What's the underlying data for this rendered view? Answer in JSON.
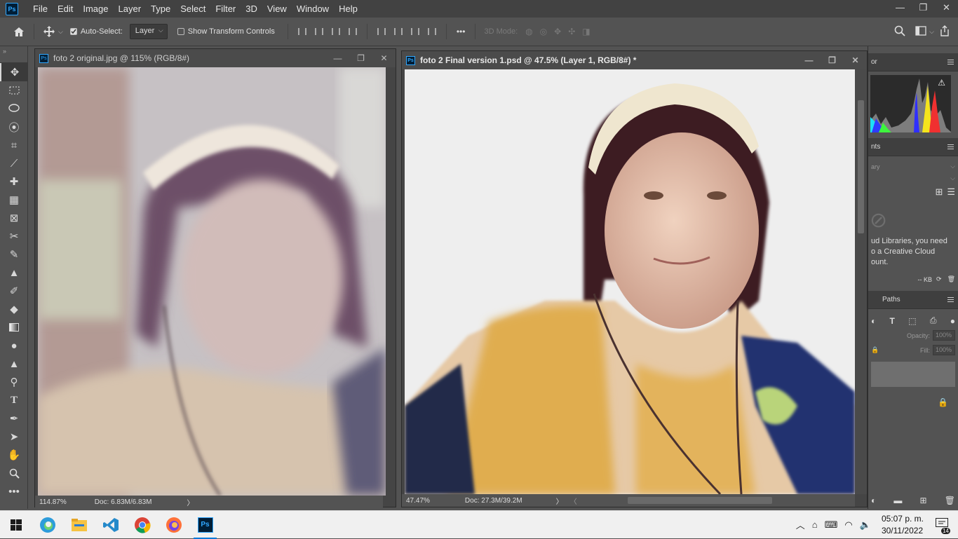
{
  "app": {
    "logo": "Ps"
  },
  "menu": [
    "File",
    "Edit",
    "Image",
    "Layer",
    "Type",
    "Select",
    "Filter",
    "3D",
    "View",
    "Window",
    "Help"
  ],
  "window_controls": {
    "minimize": "—",
    "restore": "❐",
    "close": "✕"
  },
  "options_bar": {
    "auto_select_label": "Auto-Select:",
    "auto_select_checked": true,
    "layer_select_value": "Layer",
    "show_transform_label": "Show Transform Controls",
    "show_transform_checked": false,
    "more": "•••",
    "mode_3d_label": "3D Mode:"
  },
  "documents": [
    {
      "title": "foto 2 original.jpg @ 115% (RGB/8#)",
      "zoom": "114.87%",
      "doc_size": "Doc: 6.83M/6.83M"
    },
    {
      "title": "foto 2 Final version 1.psd @ 47.5% (Layer 1, RGB/8#) *",
      "zoom": "47.47%",
      "doc_size": "Doc: 27.3M/39.2M"
    }
  ],
  "panels": {
    "histogram_tab": "or",
    "adjustments_tab": "nts",
    "library_field": "ary",
    "library_message_1": "ud Libraries, you need",
    "library_message_2": "o a Creative Cloud",
    "library_message_3": "ount.",
    "kb_label": "-- KB",
    "paths_tab": "Paths",
    "opacity_label": "Opacity:",
    "opacity_value": "100%",
    "fill_label": "Fill:",
    "fill_value": "100%"
  },
  "taskbar": {
    "time": "05:07 p. m.",
    "date": "30/11/2022",
    "notifications": "14"
  }
}
